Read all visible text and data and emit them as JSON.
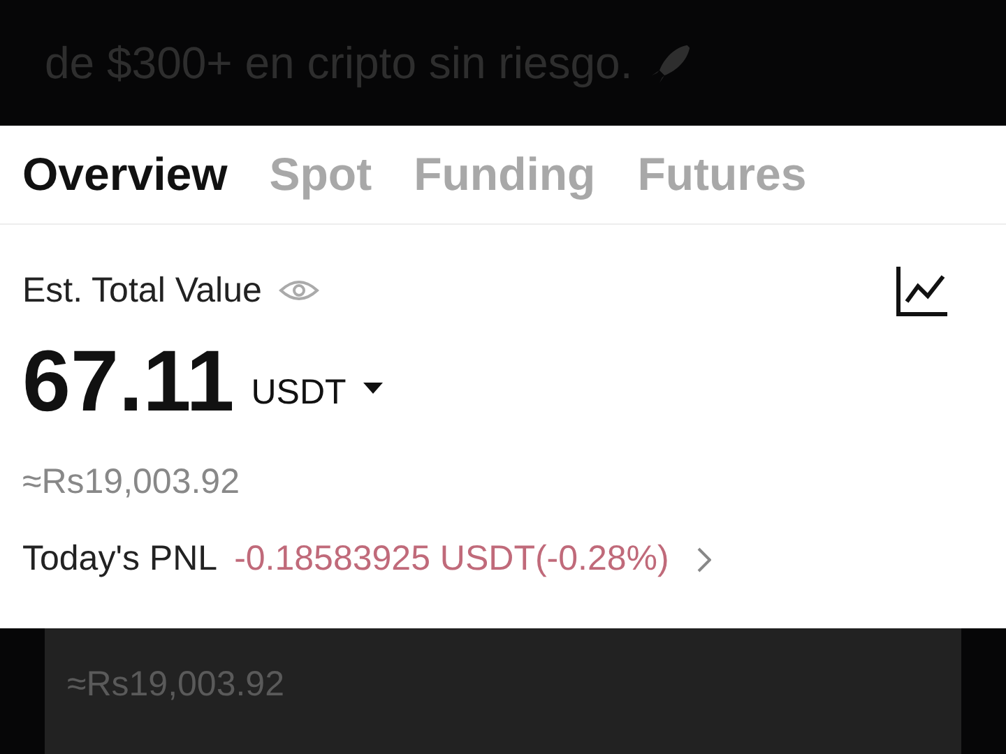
{
  "caption": {
    "text": "de $300+ en cripto sin riesgo."
  },
  "tabs": [
    {
      "label": "Overview",
      "selected": true
    },
    {
      "label": "Spot",
      "selected": false
    },
    {
      "label": "Funding",
      "selected": false
    },
    {
      "label": "Futures",
      "selected": false
    }
  ],
  "total": {
    "label": "Est. Total Value",
    "value": "67.11",
    "currency": "USDT",
    "fiat": "≈Rs19,003.92"
  },
  "pnl": {
    "label": "Today's PNL",
    "value": "-0.18583925 USDT(-0.28%)"
  },
  "dimmed_copy": {
    "fiat": "≈Rs19,003.92"
  }
}
